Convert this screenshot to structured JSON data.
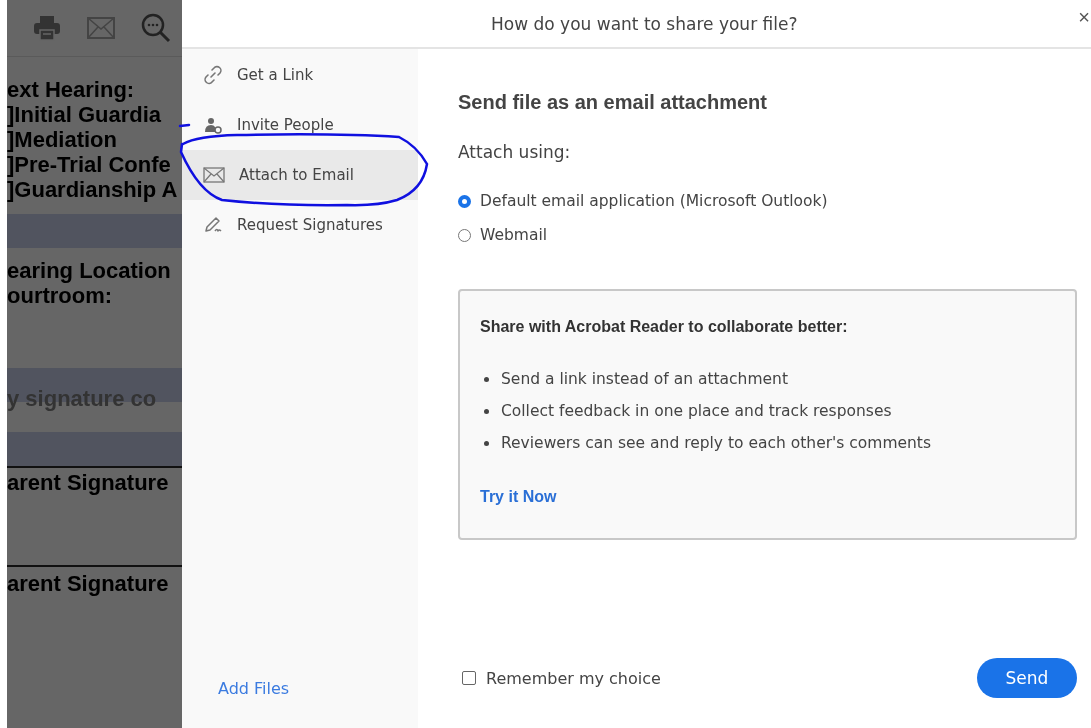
{
  "document": {
    "lines": [
      {
        "text": "ext Hearing:",
        "kind": "heading"
      },
      {
        "text": "]Initial Guardia",
        "kind": "option"
      },
      {
        "text": "]Mediation",
        "kind": "option"
      },
      {
        "text": "]Pre-Trial Confe",
        "kind": "option"
      },
      {
        "text": "]Guardianship A",
        "kind": "option"
      },
      {
        "text": "earing Location",
        "kind": "heading"
      },
      {
        "text": "ourtroom:",
        "kind": "heading"
      },
      {
        "text": "y signature co",
        "kind": "note"
      },
      {
        "text": "arent Signature",
        "kind": "signature"
      },
      {
        "text": "arent Signature",
        "kind": "signature"
      }
    ]
  },
  "dialog": {
    "title": "How do you want to share your file?",
    "close": "×",
    "sidebar": {
      "items": [
        {
          "label": "Get a Link",
          "kind": "link",
          "selected": false
        },
        {
          "label": "Invite People",
          "kind": "invite",
          "selected": false
        },
        {
          "label": "Attach to Email",
          "kind": "email",
          "selected": true
        },
        {
          "label": "Request Signatures",
          "kind": "signature",
          "selected": false
        }
      ],
      "add_files": "Add Files"
    },
    "heading": "Send file as an email attachment",
    "attach_label": "Attach using:",
    "options": [
      {
        "label": "Default email application (Microsoft Outlook)",
        "selected": true
      },
      {
        "label": "Webmail",
        "selected": false
      }
    ],
    "promo": {
      "title": "Share with Acrobat Reader to collaborate better:",
      "bullets": [
        "Send a link instead of an attachment",
        "Collect feedback in one place and track responses",
        "Reviewers can see and reply to each other's comments"
      ],
      "link": "Try it Now"
    },
    "remember": {
      "label": "Remember my choice",
      "checked": false
    },
    "send": "Send"
  }
}
